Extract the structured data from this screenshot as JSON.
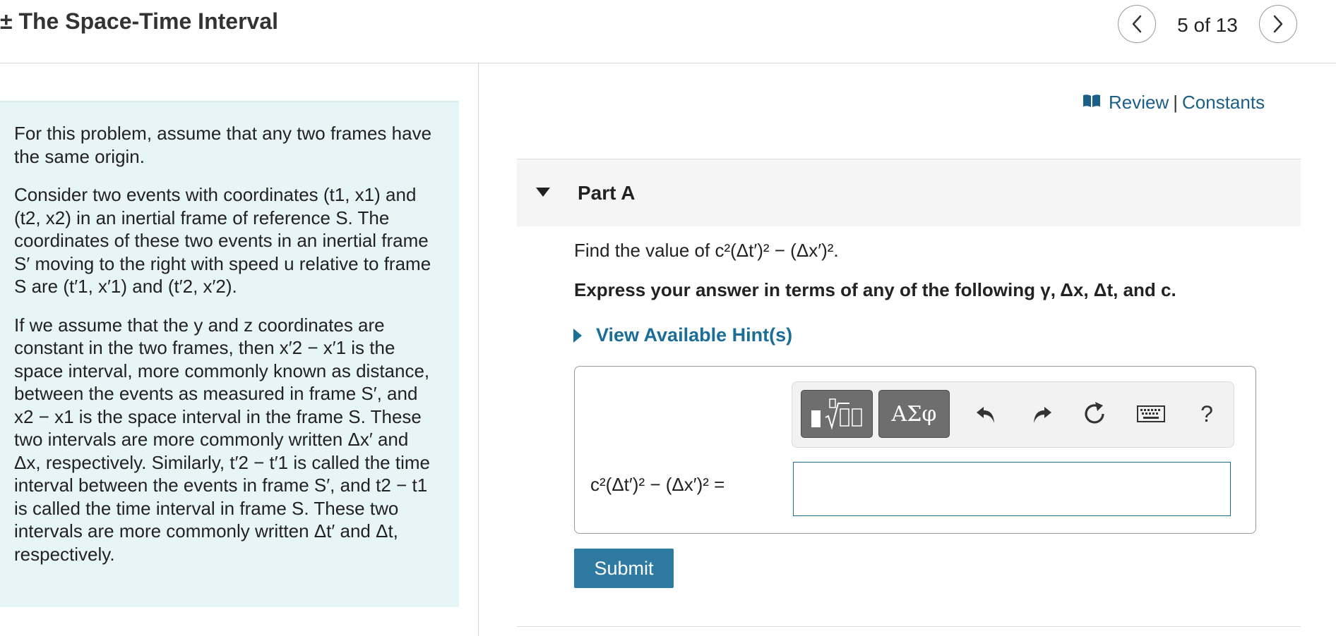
{
  "header": {
    "title": "± The Space-Time Interval",
    "page_count": "5 of 13",
    "prev_icon": "chevron-left-icon",
    "next_icon": "chevron-right-icon"
  },
  "links": {
    "icon": "book-icon",
    "review": "Review",
    "separator": "|",
    "constants": "Constants"
  },
  "info": {
    "p1": "For this problem, assume that any two frames have the same origin.",
    "p2": "Consider two events with coordinates (t1, x1) and (t2, x2) in an inertial frame of reference S. The coordinates of these two events in an inertial frame S′ moving to the right with speed u relative to frame S are (t′1, x′1) and (t′2, x′2).",
    "p3": "If we assume that the y and z coordinates are constant in the two frames, then x′2 − x′1 is the space interval, more commonly known as distance, between the events as measured in frame S′, and x2 − x1 is the space interval in the frame S. These two intervals are more commonly written Δx′ and Δx, respectively. Similarly, t′2 − t′1 is called the time interval between the events in frame S′, and t2 − t1 is called the time interval in frame S. These two intervals are more commonly written Δt′ and Δt, respectively."
  },
  "part": {
    "title": "Part A",
    "caret_icon": "caret-down-icon",
    "question": "Find the value of c²(Δt′)² − (Δx′)².",
    "instruction": "Express your answer in terms of any of the following γ, Δx, Δt, and c.",
    "hint": "View Available Hint(s)"
  },
  "toolbar": {
    "templates_icon": "templates-icon",
    "greek_label": "ΑΣφ",
    "undo_icon": "undo-icon",
    "redo_icon": "redo-icon",
    "reset_icon": "reset-icon",
    "keyboard_icon": "keyboard-icon",
    "help_label": "?"
  },
  "answer": {
    "label": "c²(Δt′)² − (Δx′)² =",
    "value": ""
  },
  "submit": {
    "label": "Submit"
  }
}
